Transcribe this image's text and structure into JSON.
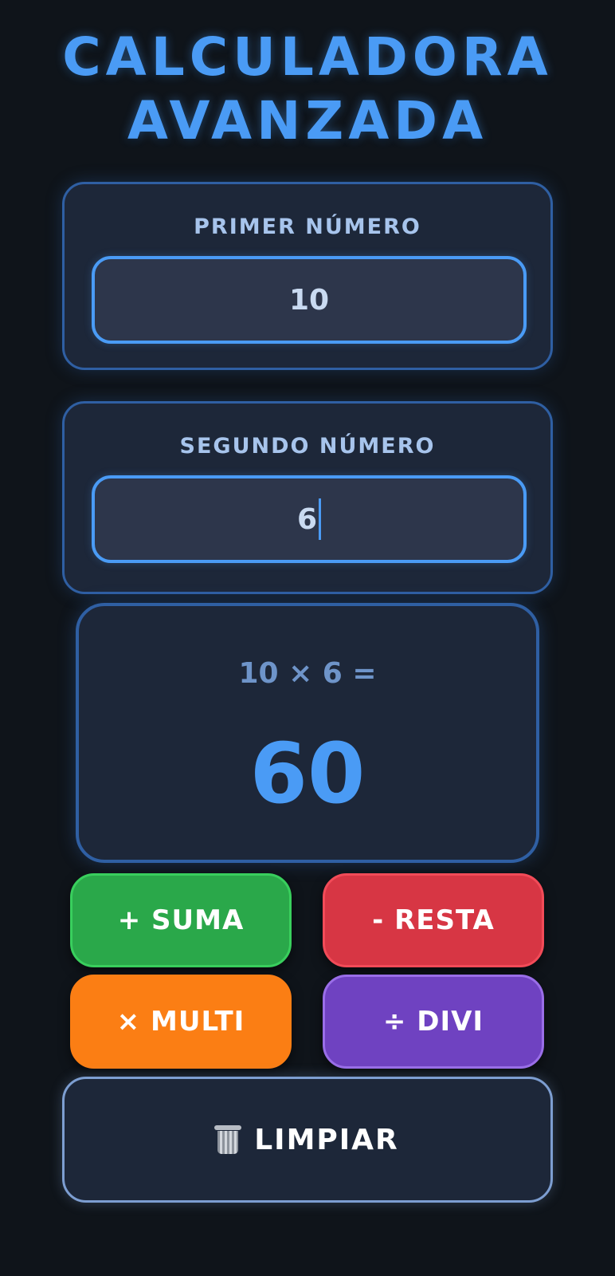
{
  "app": {
    "title_line1": "CALCULADORA",
    "title_line2": "AVANZADA"
  },
  "inputs": {
    "first": {
      "label": "PRIMER NÚMERO",
      "value": "10"
    },
    "second": {
      "label": "SEGUNDO NÚMERO",
      "value": "6"
    }
  },
  "result": {
    "expression": "10 × 6 =",
    "value": "60"
  },
  "operations": {
    "suma": "+ SUMA",
    "resta": "- RESTA",
    "multi": "× MULTI",
    "divi": "÷ DIVI"
  },
  "clear": {
    "label": "LIMPIAR",
    "icon": "trash-icon"
  },
  "colors": {
    "accent": "#4a9bf5",
    "suma": "#2aa84a",
    "resta": "#d73644",
    "multi": "#fb7e14",
    "divi": "#6f42c1"
  }
}
